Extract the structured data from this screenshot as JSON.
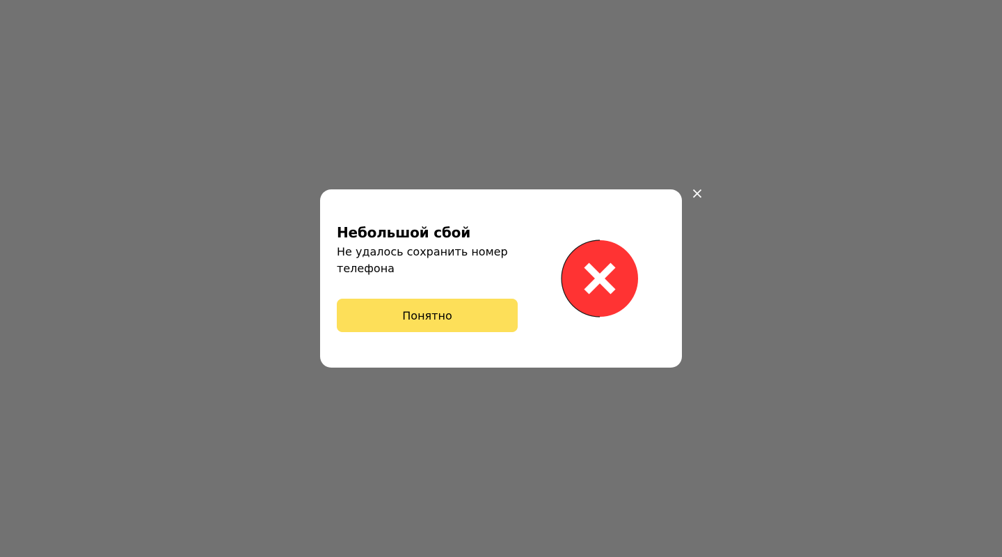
{
  "dialog": {
    "title": "Небольшой сбой",
    "message": "Не удалось сохранить номер телефона",
    "confirm_label": "Понятно",
    "close_icon": "close-icon",
    "status_icon": "error-cross-icon"
  },
  "colors": {
    "backdrop": "#727272",
    "dialog_background": "#ffffff",
    "button_background": "#fddf59",
    "error_red": "#ff3333",
    "text": "#000000"
  }
}
